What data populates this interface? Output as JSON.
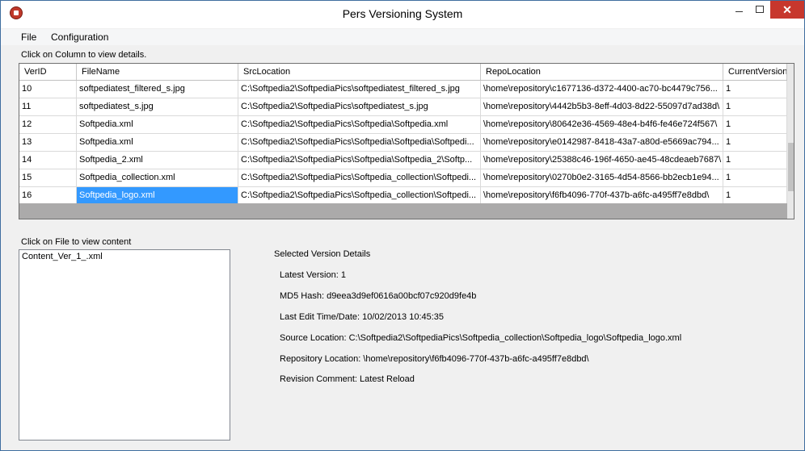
{
  "window": {
    "title": "Pers Versioning System",
    "close_glyph": "✕"
  },
  "menu": {
    "items": [
      "File",
      "Configuration"
    ]
  },
  "grid": {
    "hint": "Click on Column to view details.",
    "columns": [
      "VerID",
      "FileName",
      "SrcLocation",
      "RepoLocation",
      "CurrentVersion"
    ],
    "rows": [
      [
        "10",
        "softpediatest_filtered_s.jpg",
        "C:\\Softpedia2\\SoftpediaPics\\softpediatest_filtered_s.jpg",
        "\\home\\repository\\c1677136-d372-4400-ac70-bc4479c756...",
        "1"
      ],
      [
        "11",
        "softpediatest_s.jpg",
        "C:\\Softpedia2\\SoftpediaPics\\softpediatest_s.jpg",
        "\\home\\repository\\4442b5b3-8eff-4d03-8d22-55097d7ad38d\\",
        "1"
      ],
      [
        "12",
        "Softpedia.xml",
        "C:\\Softpedia2\\SoftpediaPics\\Softpedia\\Softpedia.xml",
        "\\home\\repository\\80642e36-4569-48e4-b4f6-fe46e724f567\\",
        "1"
      ],
      [
        "13",
        "Softpedia.xml",
        "C:\\Softpedia2\\SoftpediaPics\\Softpedia\\Softpedia\\Softpedi...",
        "\\home\\repository\\e0142987-8418-43a7-a80d-e5669ac794...",
        "1"
      ],
      [
        "14",
        "Softpedia_2.xml",
        "C:\\Softpedia2\\SoftpediaPics\\Softpedia\\Softpedia_2\\Softp...",
        "\\home\\repository\\25388c46-196f-4650-ae45-48cdeaeb7687\\",
        "1"
      ],
      [
        "15",
        "Softpedia_collection.xml",
        "C:\\Softpedia2\\SoftpediaPics\\Softpedia_collection\\Softpedi...",
        "\\home\\repository\\0270b0e2-3165-4d54-8566-bb2ecb1e94...",
        "1"
      ],
      [
        "16",
        "Softpedia_logo.xml",
        "C:\\Softpedia2\\SoftpediaPics\\Softpedia_collection\\Softpedi...",
        "\\home\\repository\\f6fb4096-770f-437b-a6fc-a495ff7e8dbd\\",
        "1"
      ]
    ],
    "selected_row": 6,
    "selected_col": 1
  },
  "files": {
    "hint": "Click on File to view content",
    "items": [
      "Content_Ver_1_.xml"
    ]
  },
  "details": {
    "title": "Selected Version Details",
    "latest_version": "Latest Version: 1",
    "md5": "MD5 Hash: d9eea3d9ef0616a00bcf07c920d9fe4b",
    "last_edit": "Last Edit Time/Date: 10/02/2013 10:45:35",
    "source": "Source Location: C:\\Softpedia2\\SoftpediaPics\\Softpedia_collection\\Softpedia_logo\\Softpedia_logo.xml",
    "repository": "Repository Location: \\home\\repository\\f6fb4096-770f-437b-a6fc-a495ff7e8dbd\\",
    "comment": "Revision Comment: Latest Reload"
  },
  "colors": {
    "selection": "#3399ff",
    "close_button": "#c7372d"
  }
}
